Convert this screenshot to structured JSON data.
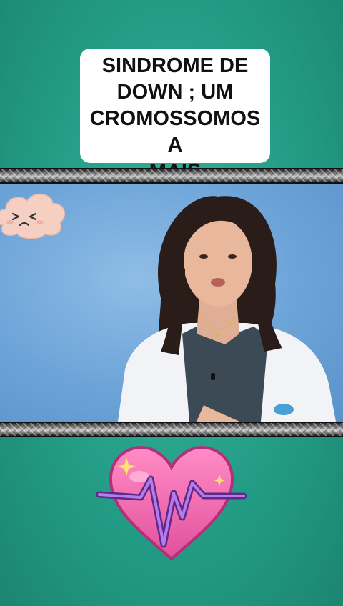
{
  "caption": {
    "title": "SINDROME DE\nDOWN ; UM\nCROMOSSOMOS A\nMAIS"
  },
  "colors": {
    "background": "#229a83",
    "video_background": "#6da4d8",
    "heart_pink": "#f06aaa",
    "pulse_purple": "#9a4dd6"
  },
  "icons": {
    "sticker_top": "sad-cloud-icon",
    "sticker_bottom": "heart-pulse-icon"
  }
}
